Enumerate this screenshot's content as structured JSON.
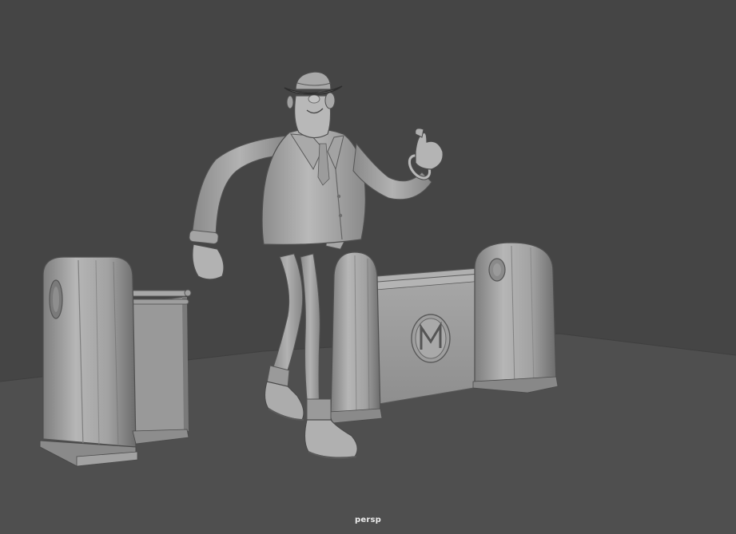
{
  "viewport": {
    "camera_name": "persp",
    "shading_mode": "smooth-shaded-no-texture",
    "colors": {
      "background": "#454545",
      "floor": "#505050",
      "model_light": "#b4b4b4",
      "model_mid": "#9a9a9a",
      "model_dark": "#6e6e6e",
      "outline": "#3a3a3a"
    }
  },
  "scene": {
    "objects": [
      {
        "name": "character",
        "icon": "man-with-hat"
      },
      {
        "name": "barrier-left",
        "icon": "pillar"
      },
      {
        "name": "barrier-right",
        "icon": "gate-panel"
      },
      {
        "name": "emblem",
        "icon": "M-medallion"
      }
    ]
  }
}
